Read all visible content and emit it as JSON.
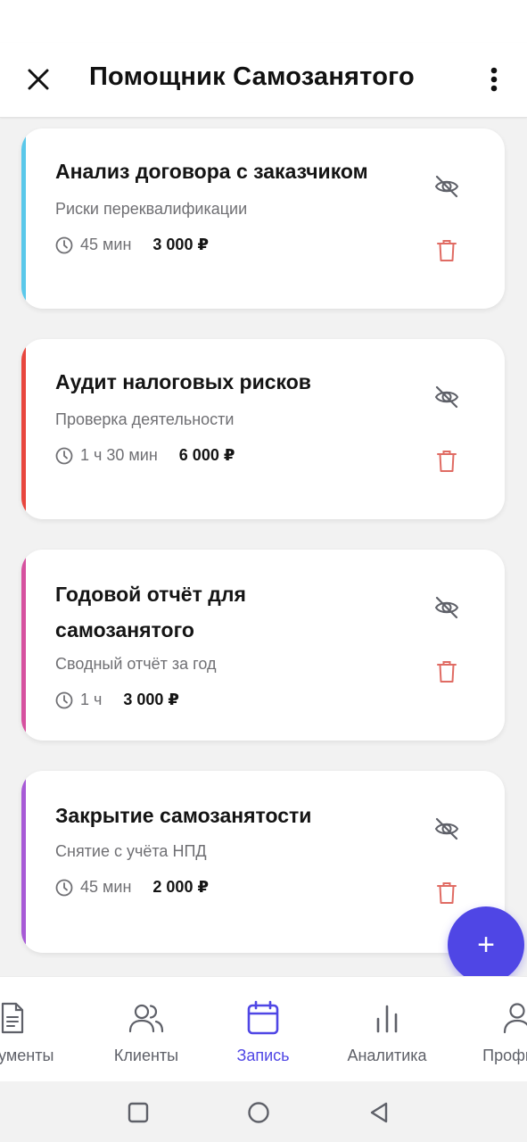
{
  "app": {
    "title": "Помощник Самозанятого"
  },
  "services": [
    {
      "title": "Анализ договора с заказчиком",
      "subtitle": "Риски переквалификации",
      "duration": "45 мин",
      "price": "3 000 ₽",
      "color": "#5ac8ea"
    },
    {
      "title": "Аудит налоговых рисков",
      "subtitle": "Проверка деятельности",
      "duration": "1 ч 30 мин",
      "price": "6 000 ₽",
      "color": "#e8463e"
    },
    {
      "title": "Годовой отчёт для самозанятого",
      "subtitle": "Сводный отчёт за год",
      "duration": "1 ч",
      "price": "3 000 ₽",
      "color": "#d6519f"
    },
    {
      "title": "Закрытие самозанятости",
      "subtitle": "Снятие с учёта НПД",
      "duration": "45 мин",
      "price": "2 000 ₽",
      "color": "#a75ad6"
    }
  ],
  "fab": {
    "label": "+"
  },
  "nav": {
    "items": [
      {
        "label": "Документы",
        "icon": "document-icon"
      },
      {
        "label": "Клиенты",
        "icon": "users-icon"
      },
      {
        "label": "Запись",
        "icon": "calendar-icon",
        "active": true
      },
      {
        "label": "Аналитика",
        "icon": "bar-chart-icon"
      },
      {
        "label": "Профиль",
        "icon": "user-icon"
      }
    ]
  },
  "colors": {
    "accent": "#4f46e5",
    "delete": "#e06b63",
    "text": "#141414",
    "muted": "#6f6f73"
  }
}
